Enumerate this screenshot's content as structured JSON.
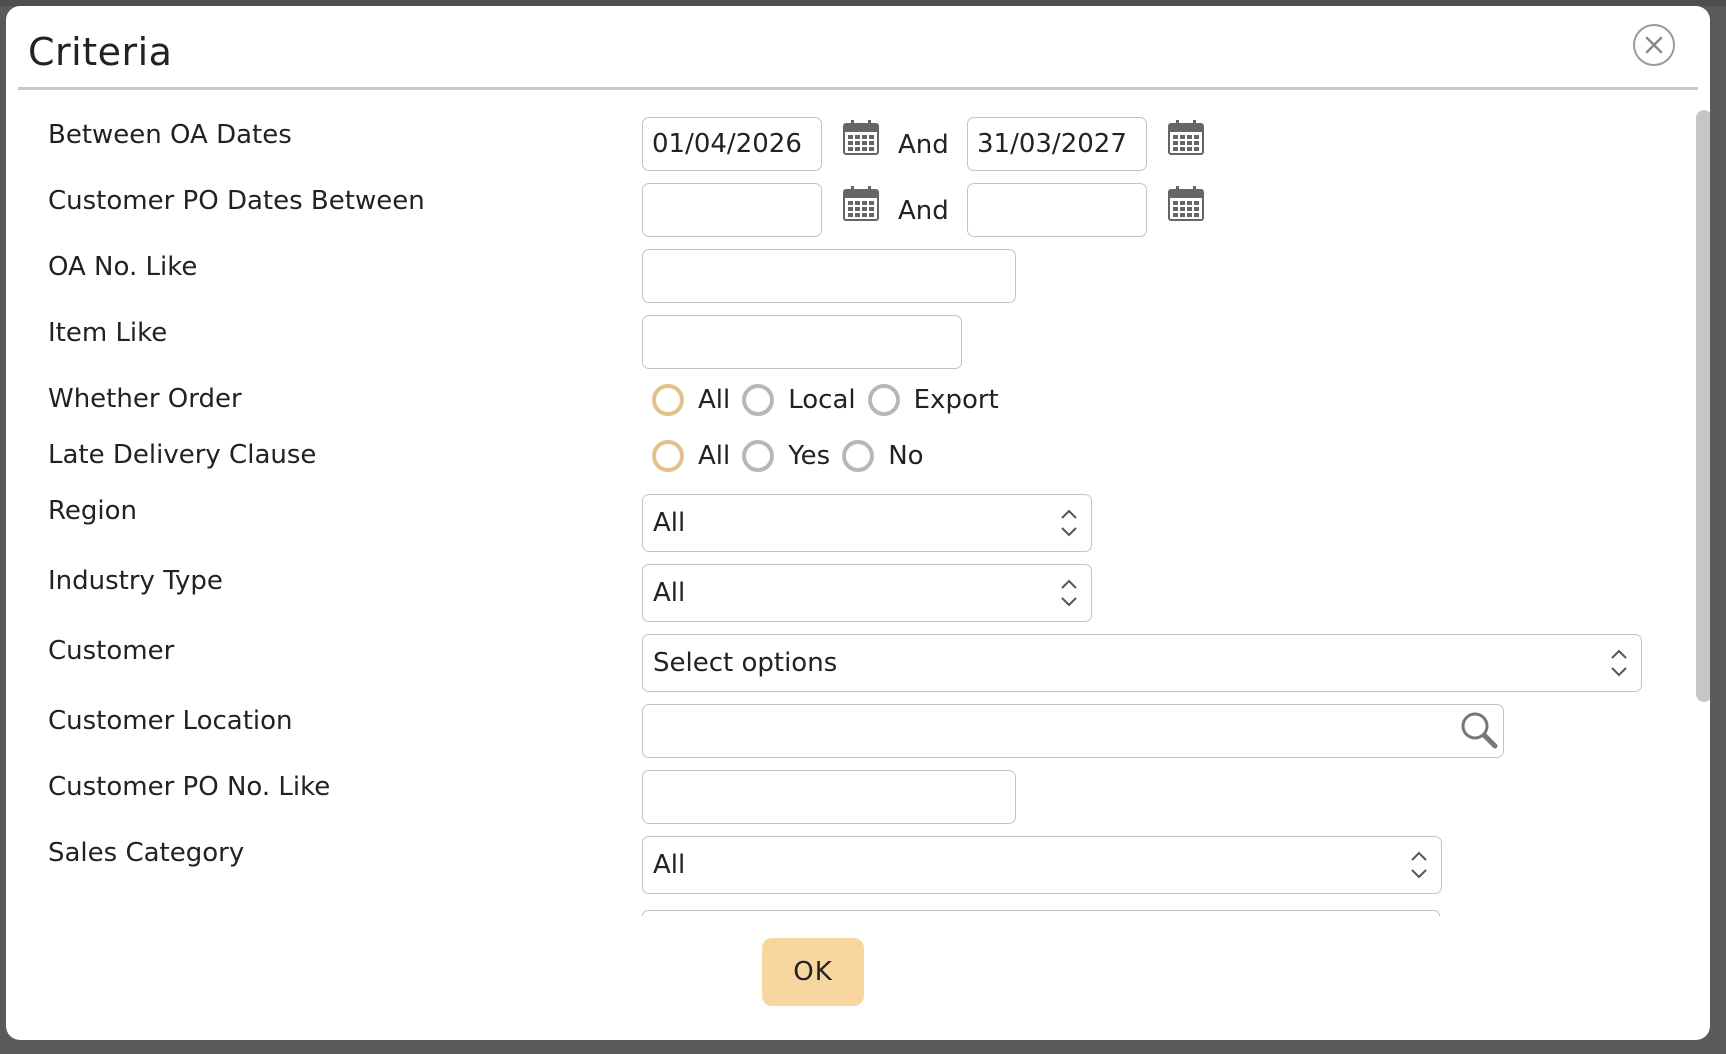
{
  "dialog": {
    "title": "Criteria"
  },
  "fields": {
    "oa_dates": {
      "label": "Between OA Dates",
      "from": "01/04/2026",
      "and": "And",
      "to": "31/03/2027"
    },
    "po_dates": {
      "label": "Customer PO Dates Between",
      "from": "",
      "and": "And",
      "to": ""
    },
    "oa_no": {
      "label": "OA No. Like",
      "value": ""
    },
    "item": {
      "label": "Item Like",
      "value": ""
    },
    "whether_order": {
      "label": "Whether Order",
      "options": [
        "All",
        "Local",
        "Export"
      ],
      "selected": "All"
    },
    "late_delivery": {
      "label": "Late Delivery Clause",
      "options": [
        "All",
        "Yes",
        "No"
      ],
      "selected": "All"
    },
    "region": {
      "label": "Region",
      "value": "All"
    },
    "industry_type": {
      "label": "Industry Type",
      "value": "All"
    },
    "customer": {
      "label": "Customer",
      "value": "Select options"
    },
    "customer_location": {
      "label": "Customer Location",
      "value": ""
    },
    "customer_po_no": {
      "label": "Customer PO No. Like",
      "value": ""
    },
    "sales_category": {
      "label": "Sales Category",
      "value": "All"
    }
  },
  "actions": {
    "ok_label": "OK"
  },
  "icons": {
    "close": "close-icon",
    "calendar": "calendar-icon",
    "search": "search-icon",
    "select_arrows": "chevron-updown-icon"
  },
  "colors": {
    "radio_checked": "#e2c18a",
    "ok_button": "#f7d79f",
    "header_rule": "#c8c8c8"
  }
}
